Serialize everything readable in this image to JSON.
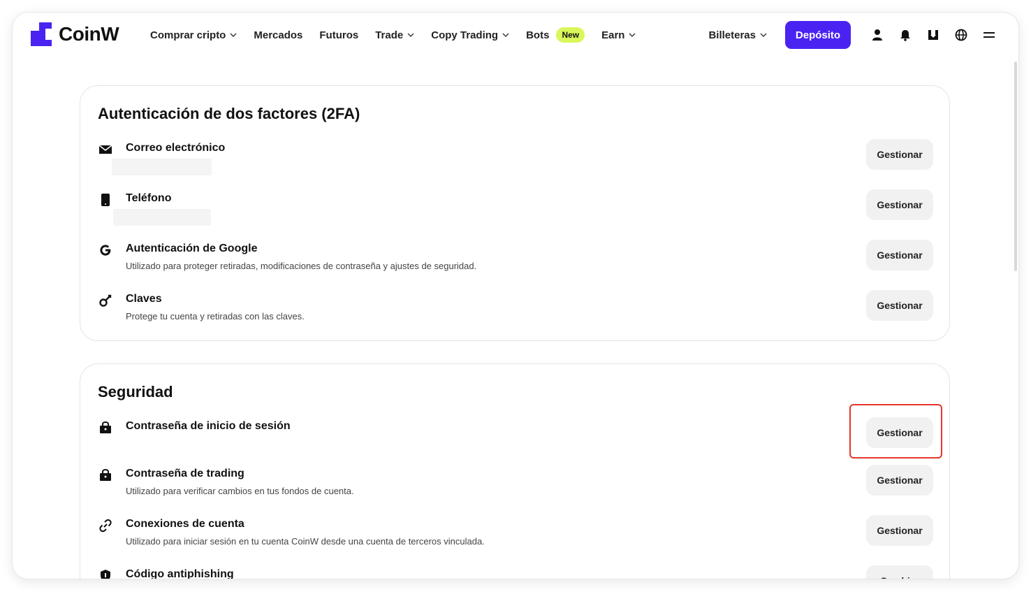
{
  "brand": {
    "name": "CoinW",
    "accent": "#4a23f2"
  },
  "nav": {
    "items": [
      {
        "label": "Comprar cripto",
        "dropdown": true
      },
      {
        "label": "Mercados",
        "dropdown": false
      },
      {
        "label": "Futuros",
        "dropdown": false
      },
      {
        "label": "Trade",
        "dropdown": true
      },
      {
        "label": "Copy Trading",
        "dropdown": true
      },
      {
        "label": "Bots",
        "dropdown": false,
        "badge": "New"
      },
      {
        "label": "Earn",
        "dropdown": true
      }
    ],
    "wallets_label": "Billeteras",
    "deposit_label": "Depósito",
    "icons": [
      "user-icon",
      "bell-icon",
      "download-icon",
      "globe-icon",
      "menu-icon"
    ]
  },
  "two_factor": {
    "title": "Autenticación de dos factores (2FA)",
    "rows": [
      {
        "icon": "mail-icon",
        "title": "Correo electrónico",
        "description": "",
        "button": "Gestionar"
      },
      {
        "icon": "phone-icon",
        "title": "Teléfono",
        "description": "",
        "button": "Gestionar"
      },
      {
        "icon": "google-icon",
        "title": "Autenticación de Google",
        "description": "Utilizado para proteger retiradas, modificaciones de contraseña y ajustes de seguridad.",
        "button": "Gestionar"
      },
      {
        "icon": "key-icon",
        "title": "Claves",
        "description": "Protege tu cuenta y retiradas con las claves.",
        "button": "Gestionar"
      }
    ]
  },
  "security": {
    "title": "Seguridad",
    "rows": [
      {
        "icon": "lock-icon",
        "title": "Contraseña de inicio de sesión",
        "description": "",
        "button": "Gestionar"
      },
      {
        "icon": "lock-icon",
        "title": "Contraseña de trading",
        "description": "Utilizado para verificar cambios en tus fondos de cuenta.",
        "button": "Gestionar"
      },
      {
        "icon": "link-icon",
        "title": "Conexiones de cuenta",
        "description": "Utilizado para iniciar sesión en tu cuenta CoinW desde una cuenta de terceros vinculada.",
        "button": "Gestionar"
      },
      {
        "icon": "shield-icon",
        "title": "Código antiphishing",
        "description": "",
        "button": "Cambiar"
      }
    ]
  }
}
